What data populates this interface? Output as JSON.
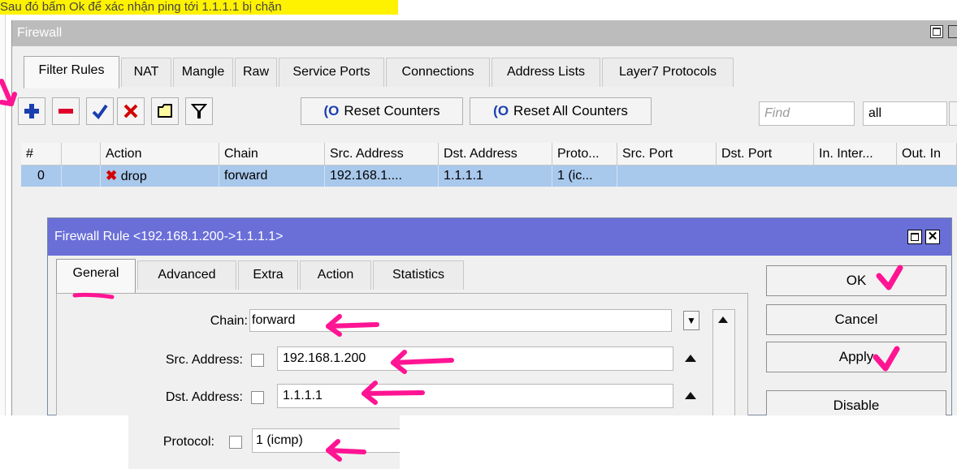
{
  "top_note": "Sau đó bấm Ok để xác nhận ping tới 1.1.1.1 bị chặn",
  "firewall": {
    "title": "Firewall",
    "tabs": [
      "Filter Rules",
      "NAT",
      "Mangle",
      "Raw",
      "Service Ports",
      "Connections",
      "Address Lists",
      "Layer7 Protocols"
    ],
    "toolbar": {
      "reset_counters": "Reset Counters",
      "reset_all_counters": "Reset All Counters",
      "find_placeholder": "Find",
      "filter_value": "all"
    },
    "columns": [
      "#",
      "",
      "Action",
      "Chain",
      "Src. Address",
      "Dst. Address",
      "Proto...",
      "Src. Port",
      "Dst. Port",
      "In. Inter...",
      "Out. In"
    ],
    "rows": [
      {
        "num": "0",
        "action": "drop",
        "chain": "forward",
        "src": "192.168.1....",
        "dst": "1.1.1.1",
        "proto": "1 (ic..."
      }
    ]
  },
  "dialog": {
    "title": "Firewall Rule <192.168.1.200->1.1.1.1>",
    "tabs": [
      "General",
      "Advanced",
      "Extra",
      "Action",
      "Statistics"
    ],
    "fields": {
      "chain_label": "Chain:",
      "chain_value": "forward",
      "src_label": "Src. Address:",
      "src_value": "192.168.1.200",
      "dst_label": "Dst. Address:",
      "dst_value": "1.1.1.1",
      "proto_label": "Protocol:",
      "proto_value": "1 (icmp)"
    },
    "buttons": {
      "ok": "OK",
      "cancel": "Cancel",
      "apply": "Apply",
      "disable": "Disable"
    }
  },
  "colors": {
    "annotation": "#ff1493",
    "dialog_title_bar": "#6a6fd8",
    "selected_row": "#a8c8ec",
    "highlight": "#fff200"
  }
}
